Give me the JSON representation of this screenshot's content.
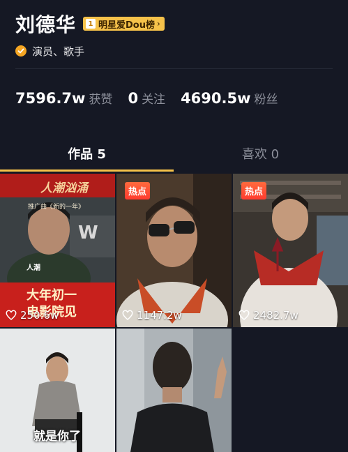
{
  "profile": {
    "name": "刘德华",
    "rank_num": "1",
    "rank_text": "明星爱Dou榜",
    "verify_text": "演员、歌手"
  },
  "stats": [
    {
      "value": "7596.7w",
      "label": "获赞"
    },
    {
      "value": "0",
      "label": "关注"
    },
    {
      "value": "4690.5w",
      "label": "粉丝"
    }
  ],
  "tabs": {
    "works": "作品 5",
    "likes": "喜欢 0"
  },
  "videos": [
    {
      "hot": "",
      "likes": "250.6w",
      "poster_title": "人潮汹涌",
      "poster_sub": "推广曲《新的一年》",
      "poster_w": "W",
      "poster_small": "人潮",
      "poster_line1": "大年初一",
      "poster_line2": "电影院见"
    },
    {
      "hot": "热点",
      "likes": "1147.2w"
    },
    {
      "hot": "热点",
      "likes": "2482.7w"
    },
    {
      "hot": "",
      "likes": "",
      "caption": "就是你了"
    },
    {
      "hot": "",
      "likes": ""
    }
  ],
  "colors": {
    "background": "#151824",
    "accent": "#f6c24a",
    "muted": "#8c8f9a",
    "hot_badge": "#ff4a34"
  }
}
